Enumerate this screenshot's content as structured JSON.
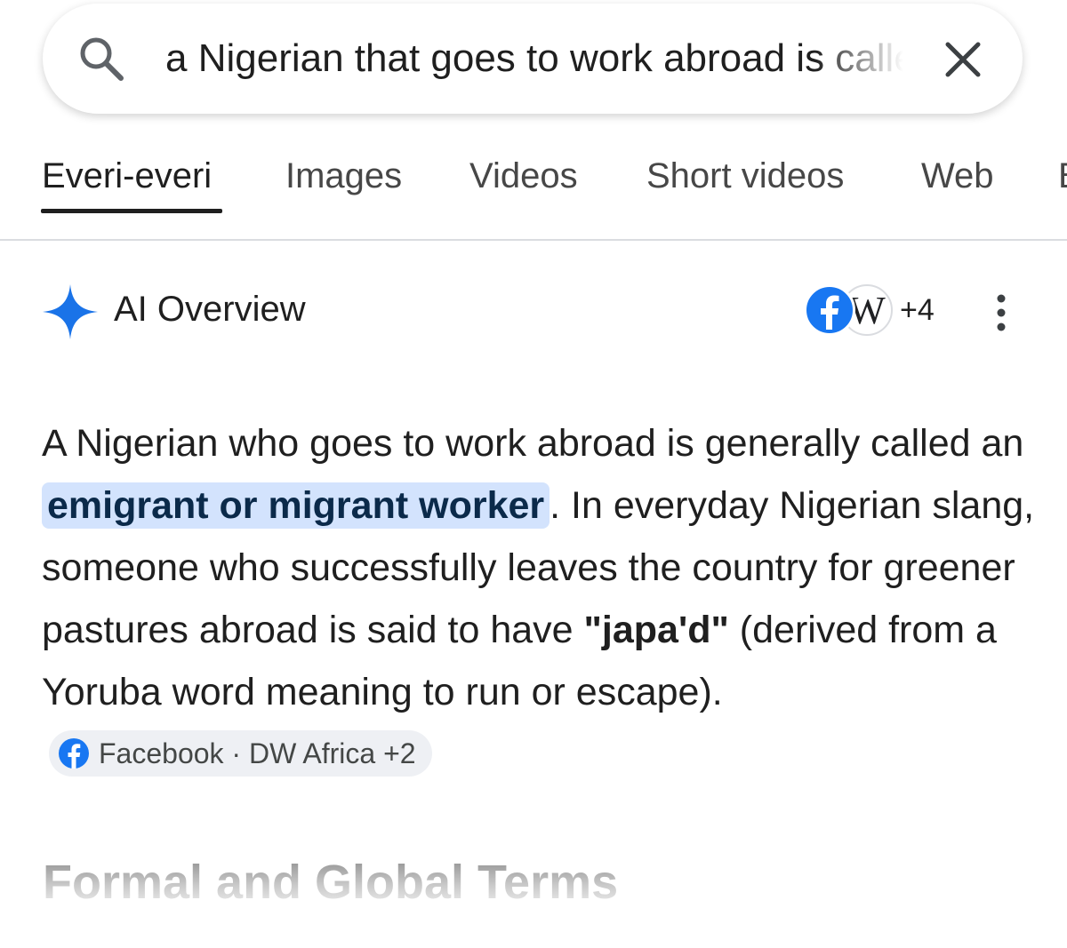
{
  "search": {
    "query": "a Nigerian that goes to work abroad is called"
  },
  "tabs": [
    {
      "label": "Everi-everi",
      "active": true
    },
    {
      "label": "Images"
    },
    {
      "label": "Videos"
    },
    {
      "label": "Short videos"
    },
    {
      "label": "Web"
    },
    {
      "label": "Books"
    }
  ],
  "ai_overview": {
    "title": "AI Overview",
    "sources_more": "+4",
    "answer": {
      "part1": "A Nigerian who goes to work abroad is generally called an ",
      "highlight": "emigrant or migrant worker",
      "part2": ". In everyday Nigerian slang, someone who successfully leaves the country for greener pastures abroad is said to have ",
      "bold_term": "\"japa'd\"",
      "part3": " (derived from a Yoruba word meaning to run or escape)."
    },
    "source_chip": {
      "label": "Facebook · DW Africa +2"
    },
    "section_heading": "Formal and Global Terms"
  },
  "colors": {
    "accent_blue": "#1a73e8",
    "facebook_blue": "#1877f2",
    "highlight_bg": "#d3e3fd"
  }
}
